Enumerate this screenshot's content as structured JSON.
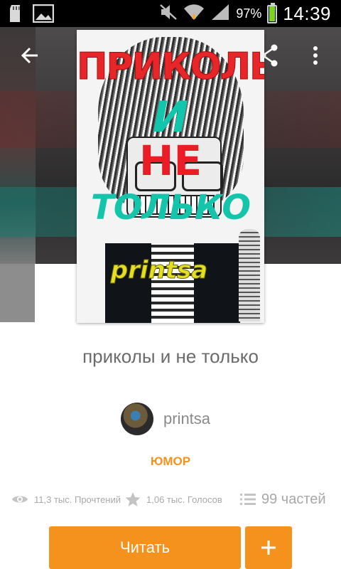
{
  "status_bar": {
    "battery": "97%",
    "battery_level": 0.97,
    "time": "14:39",
    "icons": [
      "sd-card-icon",
      "image-icon",
      "mute-icon",
      "wifi-icon",
      "signal-icon",
      "battery-icon"
    ]
  },
  "toolbar": {
    "back_icon": "arrow-left-icon",
    "share_icon": "share-icon",
    "more_icon": "more-vertical-icon"
  },
  "cover": {
    "line1": "ПРИКОЛЫ",
    "line2": "И",
    "line3": "НЕ",
    "line4": "ТОЛЬКО",
    "signature": "printsa"
  },
  "story": {
    "title": "приколы и не только",
    "author": "printsa",
    "genre": "ЮМОР"
  },
  "stats": {
    "reads": "11,3 тыс. Прочтений",
    "votes": "1,06 тыс. Голосов",
    "parts": "99 частей"
  },
  "actions": {
    "read_label": "Читать",
    "add_label": "+"
  },
  "colors": {
    "accent": "#f5921e",
    "text_gray": "#6b6b6b",
    "stat_gray": "#a8a8a8"
  }
}
